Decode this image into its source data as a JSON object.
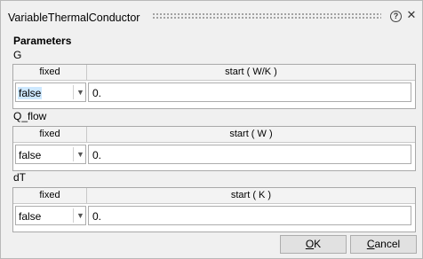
{
  "window": {
    "title": "VariableThermalConductor"
  },
  "icons": {
    "help": "?",
    "close": "✕",
    "dropdown": "chevron-down-icon"
  },
  "section_title": "Parameters",
  "params": [
    {
      "name": "G",
      "fixed_header": "fixed",
      "start_header": "start ( W/K )",
      "fixed_value": "false",
      "start_value": "0."
    },
    {
      "name": "Q_flow",
      "fixed_header": "fixed",
      "start_header": "start ( W )",
      "fixed_value": "false",
      "start_value": "0."
    },
    {
      "name": "dT",
      "fixed_header": "fixed",
      "start_header": "start ( K )",
      "fixed_value": "false",
      "start_value": "0."
    }
  ],
  "buttons": {
    "ok": {
      "mnemonic": "O",
      "rest": "K"
    },
    "cancel": {
      "mnemonic": "C",
      "rest": "ancel"
    }
  }
}
